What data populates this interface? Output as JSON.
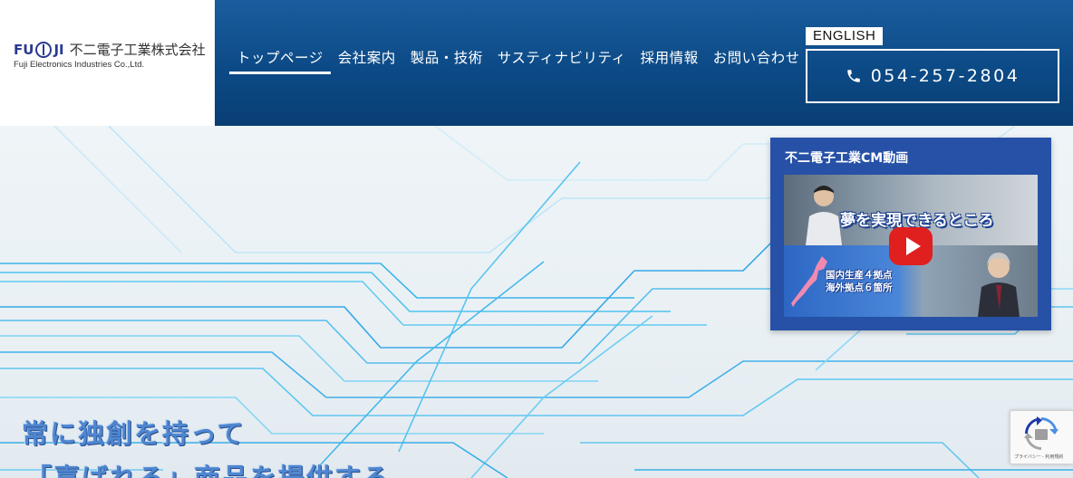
{
  "logo": {
    "brand": "FU JI",
    "brand_left": "FU",
    "brand_right": "JI",
    "company_jp": "不二電子工業株式会社",
    "company_en": "Fuji Electronics Industries Co.,Ltd."
  },
  "nav": {
    "items": [
      {
        "label": "トップページ",
        "active": true
      },
      {
        "label": "会社案内"
      },
      {
        "label": "製品・技術"
      },
      {
        "label": "サスティナビリティ"
      },
      {
        "label": "採用情報"
      },
      {
        "label": "お問い合わせ"
      }
    ]
  },
  "header": {
    "english_label": "ENGLISH",
    "phone": "054-257-2804"
  },
  "hero": {
    "line1": "常に独創を持って",
    "line2": "「喜ばれる」商品を提供する"
  },
  "cm": {
    "title": "不二電子工業CM動画",
    "thumb_headline": "夢を実現できるところ",
    "thumb_caption_1": "国内生産４拠点",
    "thumb_caption_2": "海外拠点６箇所"
  },
  "recaptcha": {
    "footer": "プライバシー - 利用規約"
  },
  "colors": {
    "header_blue": "#0c4a86",
    "card_blue": "#2651a6",
    "hero_text": "#4f86d0",
    "play_red": "#e01f1f"
  },
  "icons": [
    "phone-icon",
    "play-icon",
    "recaptcha-icon"
  ]
}
